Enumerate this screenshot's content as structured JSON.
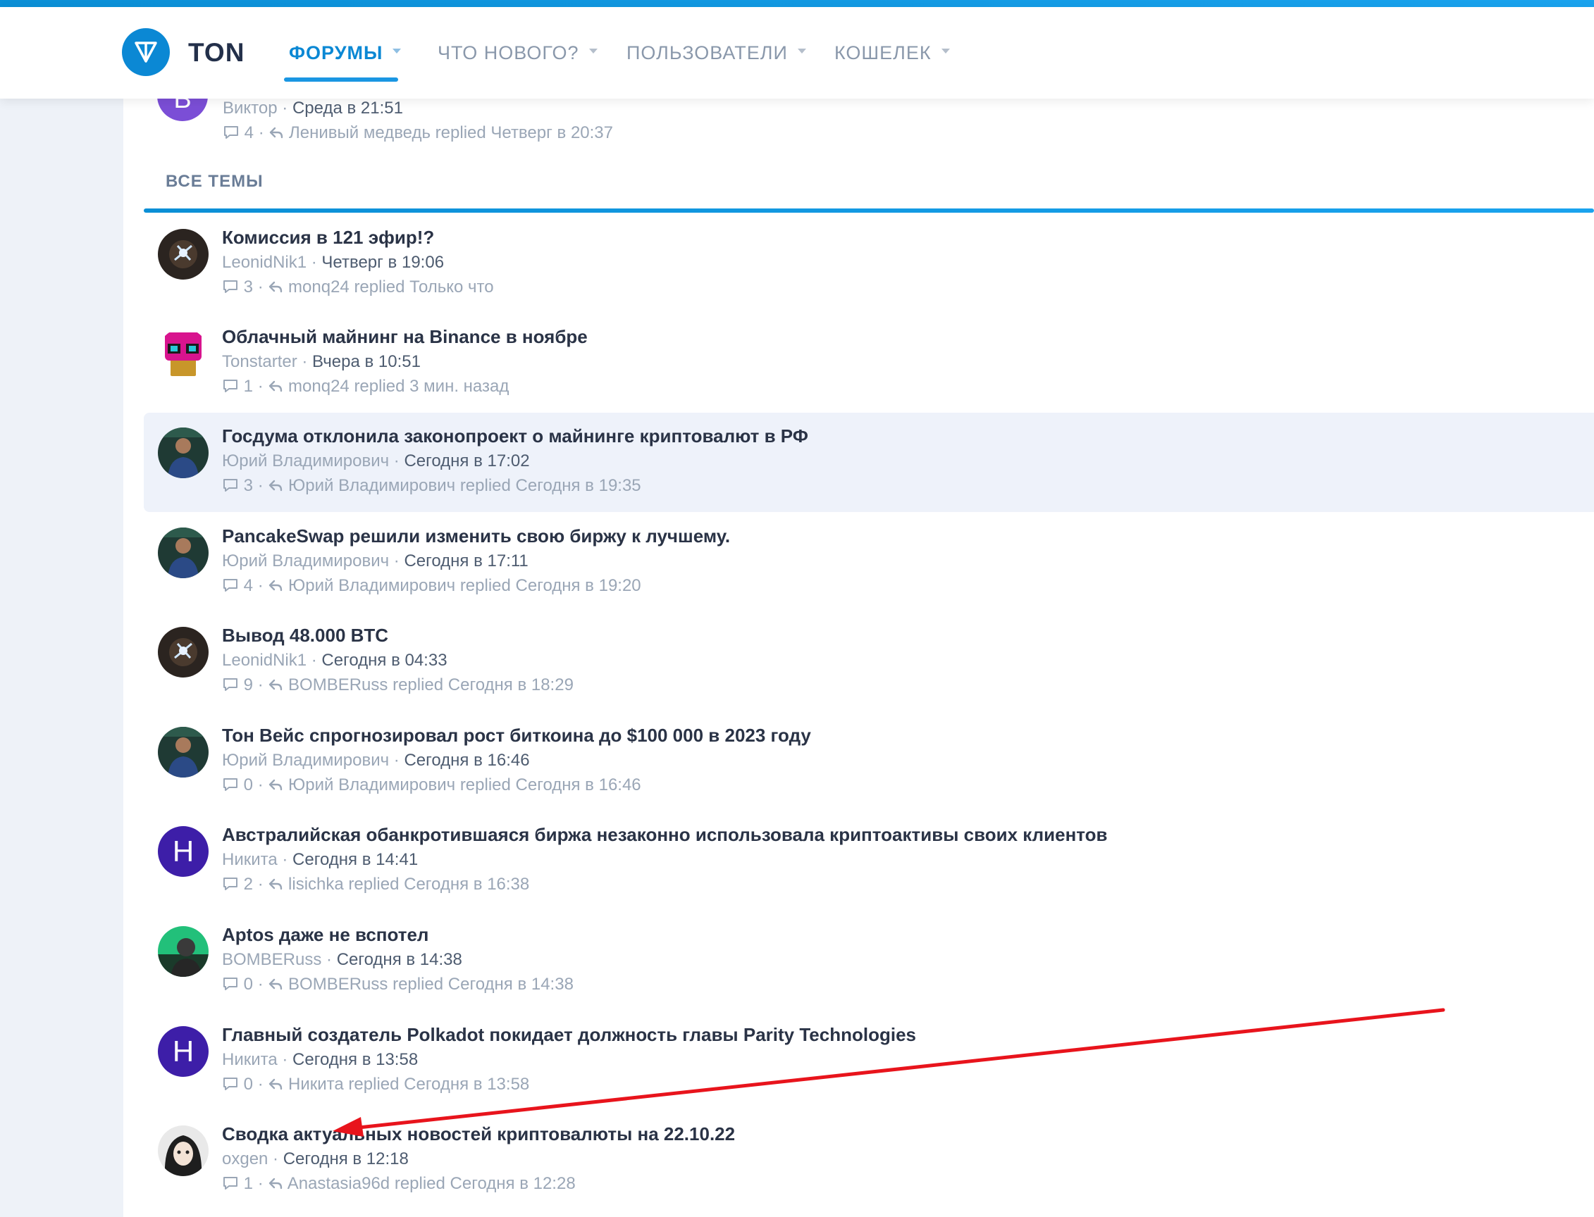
{
  "header": {
    "brand": "TON",
    "nav": [
      {
        "label": "ФОРУМЫ",
        "active": true
      },
      {
        "label": "ЧТО НОВОГО?"
      },
      {
        "label": "ПОЛЬЗОВАТЕЛИ"
      },
      {
        "label": "КОШЕЛЕК"
      }
    ]
  },
  "previous_thread": {
    "avatar_letter": "В",
    "author": "Виктор",
    "date": "Среда в 21:51",
    "replies": "4",
    "last_replier": "Ленивый медведь",
    "replied_word": "replied",
    "last_date": "Четверг в 20:37"
  },
  "section": {
    "title": "ВСЕ ТЕМЫ"
  },
  "threads": [
    {
      "title": "Комиссия в 121 эфир!?",
      "author": "LeonidNik1",
      "date": "Четверг в 19:06",
      "replies": "3",
      "last_replier": "monq24",
      "replied_word": "replied",
      "last_date": "Только что"
    },
    {
      "title": "Облачный майнинг на Binance в ноябре",
      "author": "Tonstarter",
      "date": "Вчера в 10:51",
      "replies": "1",
      "last_replier": "monq24",
      "replied_word": "replied",
      "last_date": "3 мин. назад"
    },
    {
      "title": "Госдума отклонила законопроект о майнинге криптовалют в РФ",
      "author": "Юрий Владимирович",
      "date": "Сегодня в 17:02",
      "replies": "3",
      "last_replier": "Юрий Владимирович",
      "replied_word": "replied",
      "last_date": "Сегодня в 19:35"
    },
    {
      "title": "PancakeSwap решили изменить свою биржу к лучшему.",
      "author": "Юрий Владимирович",
      "date": "Сегодня в 17:11",
      "replies": "4",
      "last_replier": "Юрий Владимирович",
      "replied_word": "replied",
      "last_date": "Сегодня в 19:20"
    },
    {
      "title": "Вывод 48.000 BTC",
      "author": "LeonidNik1",
      "date": "Сегодня в 04:33",
      "replies": "9",
      "last_replier": "BOMBERuss",
      "replied_word": "replied",
      "last_date": "Сегодня в 18:29"
    },
    {
      "title": "Тон Вейс спрогнозировал рост биткоина до $100 000 в 2023 году",
      "author": "Юрий Владимирович",
      "date": "Сегодня в 16:46",
      "replies": "0",
      "last_replier": "Юрий Владимирович",
      "replied_word": "replied",
      "last_date": "Сегодня в 16:46"
    },
    {
      "title": "Австралийская обанкротившаяся биржа незаконно использовала криптоактивы своих клиентов",
      "author": "Никита",
      "date": "Сегодня в 14:41",
      "replies": "2",
      "last_replier": "lisichka",
      "replied_word": "replied",
      "last_date": "Сегодня в 16:38",
      "avatar_letter": "Н"
    },
    {
      "title": "Aptos даже не вспотел",
      "author": "BOMBERuss",
      "date": "Сегодня в 14:38",
      "replies": "0",
      "last_replier": "BOMBERuss",
      "replied_word": "replied",
      "last_date": "Сегодня в 14:38"
    },
    {
      "title": "Главный создатель Polkadot покидает должность главы Parity Technologies",
      "author": "Никита",
      "date": "Сегодня в 13:58",
      "replies": "0",
      "last_replier": "Никита",
      "replied_word": "replied",
      "last_date": "Сегодня в 13:58",
      "avatar_letter": "Н"
    },
    {
      "title": "Сводка актуальных новостей криптовалюты на 22.10.22",
      "author": "oxgen",
      "date": "Сегодня в 12:18",
      "replies": "1",
      "last_replier": "Anastasia96d",
      "replied_word": "replied",
      "last_date": "Сегодня в 12:28"
    }
  ],
  "colors": {
    "accent": "#0b88d4",
    "annotation_arrow": "#e8141c",
    "highlight_row": "#eef2fa"
  }
}
